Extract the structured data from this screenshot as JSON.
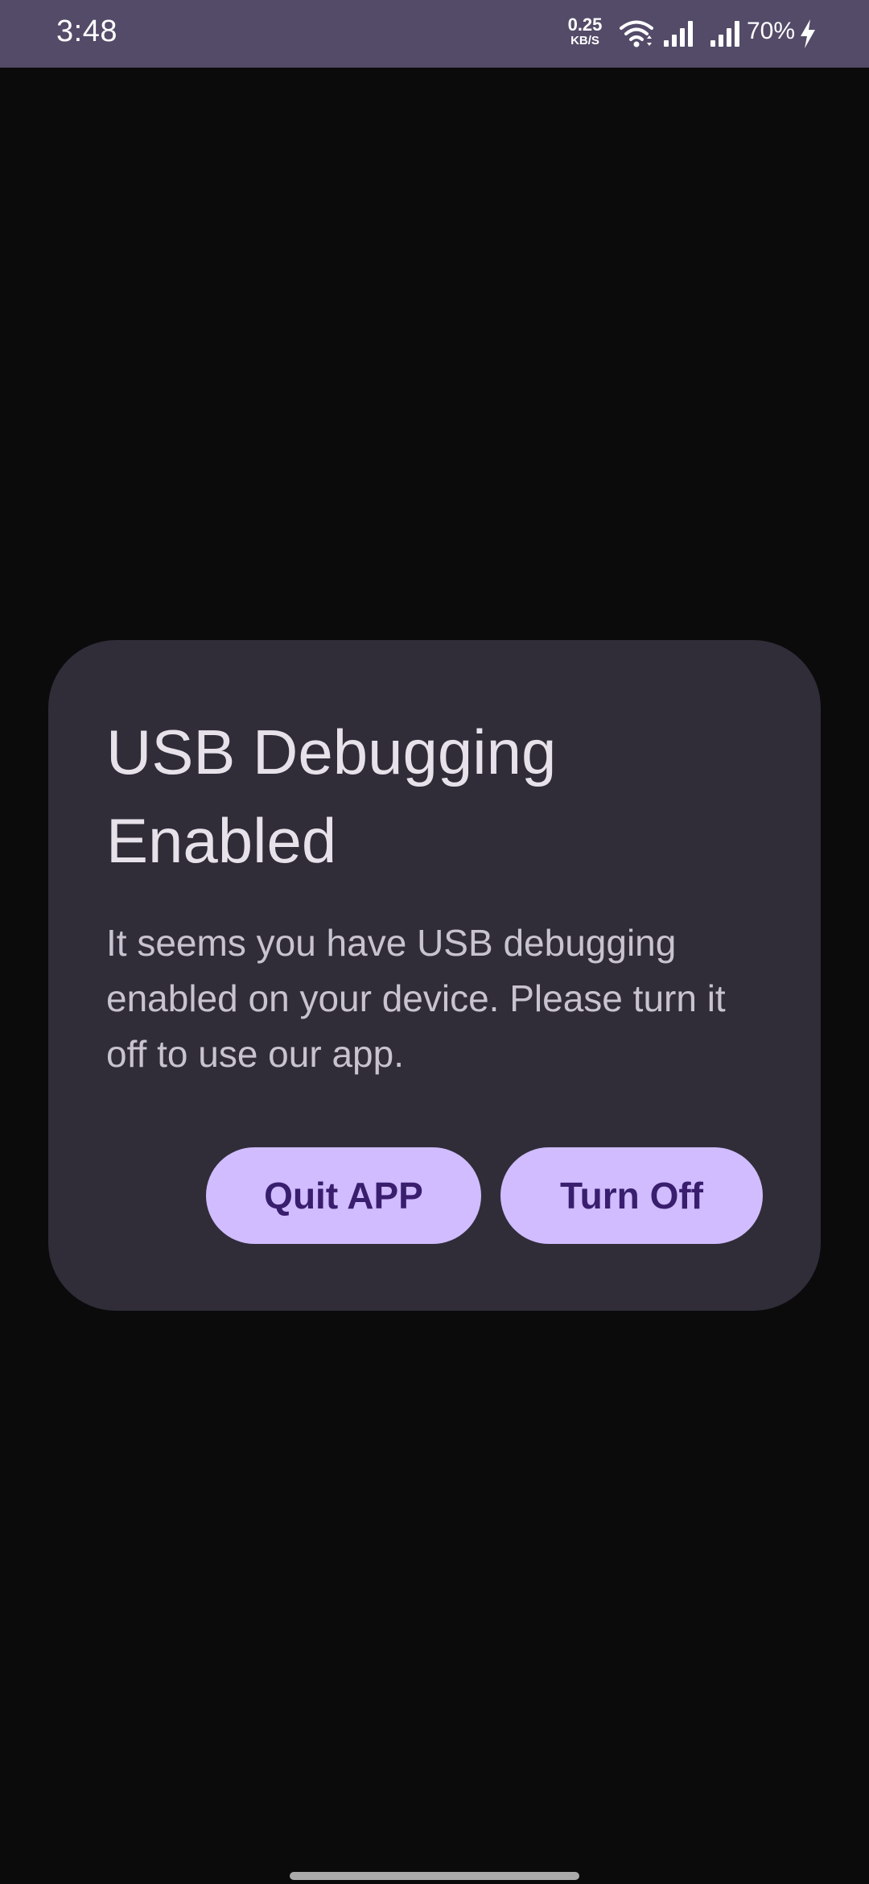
{
  "status_bar": {
    "time": "3:48",
    "net_speed_value": "0.25",
    "net_speed_unit": "KB/S",
    "wifi_icon": "wifi-icon",
    "signal_icons": [
      "signal-icon",
      "signal-icon"
    ],
    "battery_percent": "70%",
    "charging_icon": "bolt-icon",
    "background_color": "#534b68"
  },
  "dialog": {
    "title": "USB Debugging Enabled",
    "message": "It seems you have USB debugging enabled on your device. Please turn it off to use our app.",
    "buttons": {
      "quit_label": "Quit APP",
      "turn_off_label": "Turn Off"
    },
    "background_color": "#302d39",
    "button_color": "#d0bcff",
    "button_text_color": "#3a1e6e"
  },
  "screen": {
    "background_color": "#0b0b0c"
  }
}
